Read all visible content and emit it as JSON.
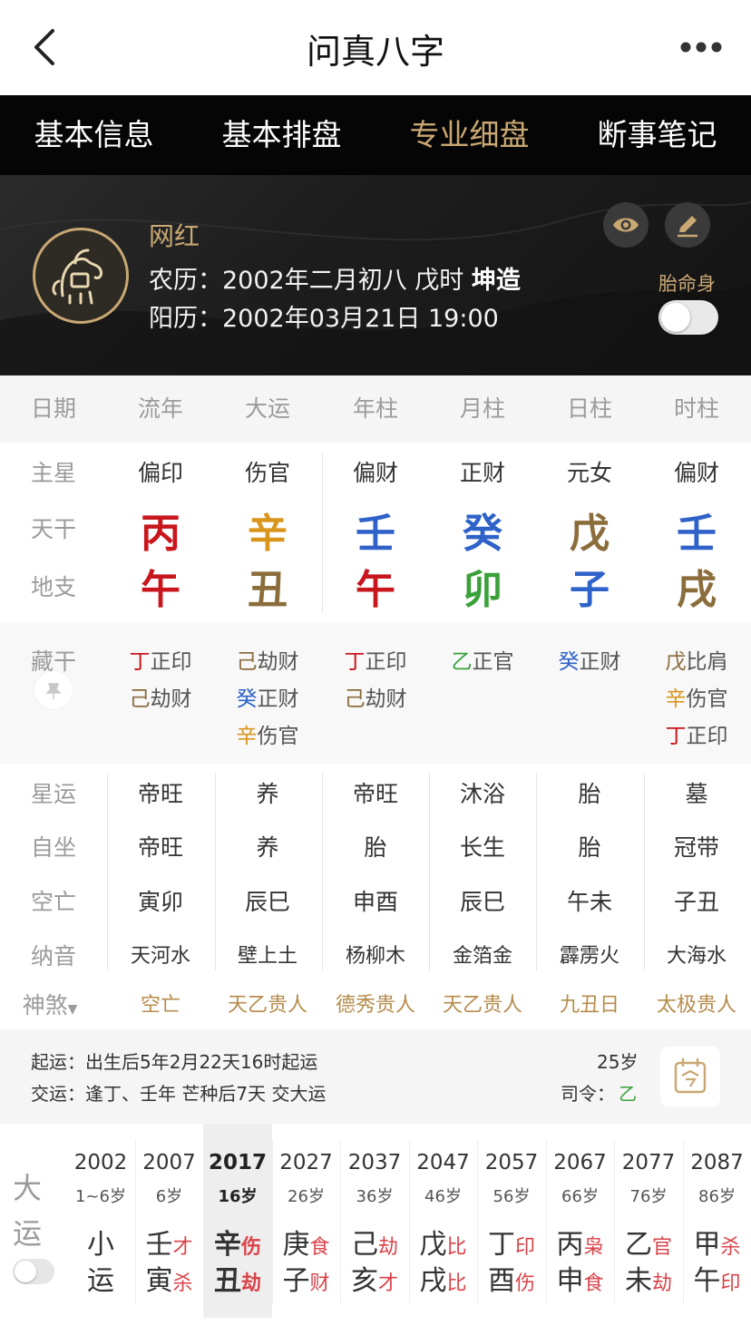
{
  "header": {
    "title": "问真八字"
  },
  "tabs": [
    {
      "label": "基本信息",
      "active": false
    },
    {
      "label": "基本排盘",
      "active": false
    },
    {
      "label": "专业细盘",
      "active": true
    },
    {
      "label": "断事笔记",
      "active": false
    }
  ],
  "profile": {
    "name": "网红",
    "lunar_label": "农历：",
    "lunar_value": "2002年二月初八 戊时",
    "gender": "坤造",
    "solar_label": "阳历：",
    "solar_value": "2002年03月21日 19:00",
    "toggle_label": "胎命身"
  },
  "columns": [
    "日期",
    "流年",
    "大运",
    "年柱",
    "月柱",
    "日柱",
    "时柱"
  ],
  "row_labels": {
    "zhuxing": "主星",
    "tiangan": "天干",
    "dizhi": "地支",
    "canggan": "藏干",
    "xingyun": "星运",
    "zizuo": "自坐",
    "kongwang": "空亡",
    "nayin": "纳音",
    "shensha": "神煞"
  },
  "zhuxing": [
    "偏印",
    "伤官",
    "偏财",
    "正财",
    "元女",
    "偏财"
  ],
  "tiangan": [
    {
      "char": "丙",
      "color": "#c8161d"
    },
    {
      "char": "辛",
      "color": "#d8961d"
    },
    {
      "char": "壬",
      "color": "#2f62c9"
    },
    {
      "char": "癸",
      "color": "#2f62c9"
    },
    {
      "char": "戊",
      "color": "#8a6d3b"
    },
    {
      "char": "壬",
      "color": "#2f62c9"
    }
  ],
  "dizhi": [
    {
      "char": "午",
      "color": "#c8161d"
    },
    {
      "char": "丑",
      "color": "#8a6d3b"
    },
    {
      "char": "午",
      "color": "#c8161d"
    },
    {
      "char": "卯",
      "color": "#3aa13a"
    },
    {
      "char": "子",
      "color": "#2f62c9"
    },
    {
      "char": "戌",
      "color": "#8a6d3b"
    }
  ],
  "canggan": [
    [
      {
        "gan": "丁",
        "color": "#c8161d",
        "shen": "正印"
      },
      {
        "gan": "己",
        "color": "#8a6d3b",
        "shen": "劫财"
      }
    ],
    [
      {
        "gan": "己",
        "color": "#8a6d3b",
        "shen": "劫财"
      },
      {
        "gan": "癸",
        "color": "#2f62c9",
        "shen": "正财"
      },
      {
        "gan": "辛",
        "color": "#d8961d",
        "shen": "伤官"
      }
    ],
    [
      {
        "gan": "丁",
        "color": "#c8161d",
        "shen": "正印"
      },
      {
        "gan": "己",
        "color": "#8a6d3b",
        "shen": "劫财"
      }
    ],
    [
      {
        "gan": "乙",
        "color": "#3aa13a",
        "shen": "正官"
      }
    ],
    [
      {
        "gan": "癸",
        "color": "#2f62c9",
        "shen": "正财"
      }
    ],
    [
      {
        "gan": "戊",
        "color": "#8a6d3b",
        "shen": "比肩"
      },
      {
        "gan": "辛",
        "color": "#d8961d",
        "shen": "伤官"
      },
      {
        "gan": "丁",
        "color": "#c8161d",
        "shen": "正印"
      }
    ]
  ],
  "xingyun": [
    "帝旺",
    "养",
    "帝旺",
    "沐浴",
    "胎",
    "墓"
  ],
  "zizuo": [
    "帝旺",
    "养",
    "胎",
    "长生",
    "胎",
    "冠带"
  ],
  "kongwang": [
    "寅卯",
    "辰巳",
    "申酉",
    "辰巳",
    "午未",
    "子丑"
  ],
  "nayin": [
    "天河水",
    "壁上土",
    "杨柳木",
    "金箔金",
    "霹雳火",
    "大海水"
  ],
  "shensha": [
    "空亡",
    "天乙贵人",
    "德秀贵人",
    "天乙贵人",
    "九丑日",
    "太极贵人"
  ],
  "qiyun": {
    "line1": "起运：出生后5年2月22天16时起运",
    "line2": "交运：逢丁、壬年 芒种后7天 交大运",
    "age": "25岁",
    "siling_label": "司令：",
    "siling_value": "乙"
  },
  "dayun": {
    "label_top": "大",
    "label_bottom": "运",
    "columns": [
      {
        "year": "2002",
        "age": "1~6岁",
        "top": "小",
        "top_ss": "",
        "bottom": "运",
        "bottom_ss": "",
        "selected": false
      },
      {
        "year": "2007",
        "age": "6岁",
        "top": "壬",
        "top_ss": "才",
        "bottom": "寅",
        "bottom_ss": "杀",
        "selected": false
      },
      {
        "year": "2017",
        "age": "16岁",
        "top": "辛",
        "top_ss": "伤",
        "bottom": "丑",
        "bottom_ss": "劫",
        "selected": true
      },
      {
        "year": "2027",
        "age": "26岁",
        "top": "庚",
        "top_ss": "食",
        "bottom": "子",
        "bottom_ss": "财",
        "selected": false
      },
      {
        "year": "2037",
        "age": "36岁",
        "top": "己",
        "top_ss": "劫",
        "bottom": "亥",
        "bottom_ss": "才",
        "selected": false
      },
      {
        "year": "2047",
        "age": "46岁",
        "top": "戊",
        "top_ss": "比",
        "bottom": "戌",
        "bottom_ss": "比",
        "selected": false
      },
      {
        "year": "2057",
        "age": "56岁",
        "top": "丁",
        "top_ss": "印",
        "bottom": "酉",
        "bottom_ss": "伤",
        "selected": false
      },
      {
        "year": "2067",
        "age": "66岁",
        "top": "丙",
        "top_ss": "枭",
        "bottom": "申",
        "bottom_ss": "食",
        "selected": false
      },
      {
        "year": "2077",
        "age": "76岁",
        "top": "乙",
        "top_ss": "官",
        "bottom": "未",
        "bottom_ss": "劫",
        "selected": false
      },
      {
        "year": "2087",
        "age": "86岁",
        "top": "甲",
        "top_ss": "杀",
        "bottom": "午",
        "bottom_ss": "印",
        "selected": false
      }
    ]
  }
}
